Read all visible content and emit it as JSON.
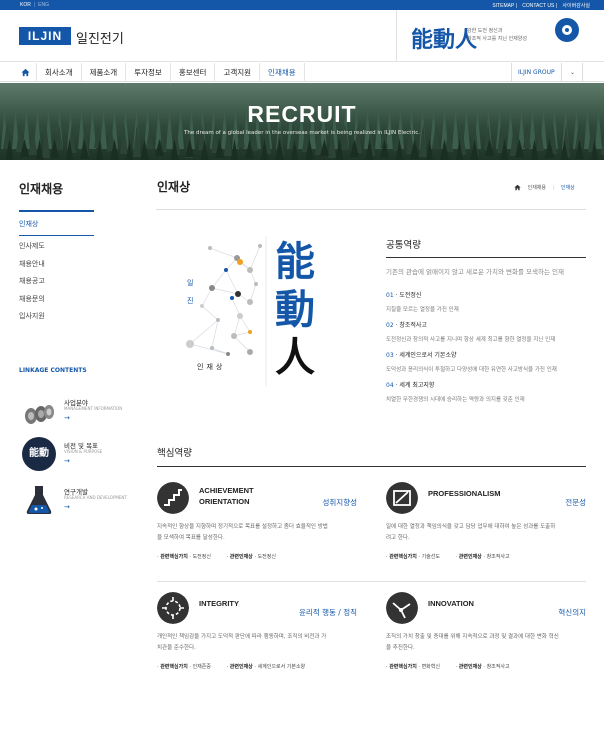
{
  "topbar": {
    "lang_kor": "KOR",
    "lang_eng": "ENG",
    "sitemap": "SITEMAP",
    "contact": "CONTACT US",
    "audit": "사이버감사실"
  },
  "header": {
    "logo": "ILJIN",
    "company": "일진전기",
    "slogan_main": "能動人",
    "slogan_line1": "강한 도전 정신과",
    "slogan_line2": "창조적 사고를 지닌 인재양성"
  },
  "nav": {
    "items": [
      "회사소개",
      "제품소개",
      "투자정보",
      "홍보센터",
      "고객지원",
      "인재채용"
    ],
    "group": "ILJIN GROUP",
    "chevron": "⌄"
  },
  "hero": {
    "title": "RECRUIT",
    "subtitle": "The dream of a global leader in the overseas market is being realized in ILJIN Electric."
  },
  "sidebar": {
    "title": "인재채용",
    "active": "인재상",
    "items": [
      "인사제도",
      "채용안내",
      "채용공고",
      "채용문의",
      "입사지원"
    ]
  },
  "linkage": {
    "title": "LINKAGE CONTENTS",
    "items": [
      {
        "label": "사업분야",
        "sub": "MANAGEMENT INFORMATION",
        "arrow": "→",
        "icon": "cable-reel-icon"
      },
      {
        "label": "비전 및 목표",
        "sub": "VISION & PURPOSE",
        "arrow": "→",
        "icon": "vision-badge-icon",
        "badge": "能動"
      },
      {
        "label": "연구개발",
        "sub": "RESEARCH AND DEVELOPMENT",
        "arrow": "→",
        "icon": "flask-icon"
      }
    ]
  },
  "main": {
    "title": "인재상",
    "breadcrumb": [
      "인재채용",
      "인재상"
    ]
  },
  "art": {
    "kanji1": "能",
    "kanji2": "動",
    "kanji3": "人",
    "side1": "일",
    "side2": "진",
    "label": "인재상"
  },
  "common": {
    "title": "공통역량",
    "desc": "기존의 관습에 얽매이지 않고 새로운 가치와 변화를 모색하는 인재",
    "items": [
      {
        "num": "01",
        "name": "도전정신",
        "desc": "지칠줄 모르는 열정을 가진 인재"
      },
      {
        "num": "02",
        "name": "창조적사고",
        "desc": "도전정신과 창의적 사고를 지니며 항상 세계 최고를 향한 열정을 지닌 인재"
      },
      {
        "num": "03",
        "name": "세계인으로서 기본소양",
        "desc": "도덕성과 윤리의식이 투철하고 다양성에 대한 유연한 사고방식을 가진 인재"
      },
      {
        "num": "04",
        "name": "세계 최고지향",
        "desc": "치열한 무한경쟁의 시대에 승리하는 역량과 의지를 갖춘 인재"
      }
    ]
  },
  "core": {
    "title": "핵심역량",
    "cards": [
      {
        "en1": "ACHIEVEMENT",
        "en2": "ORIENTATION",
        "kr": "성취지향성",
        "icon": "stairs-icon",
        "desc1": "지속적인 향상을 지향하며 정기적으로 목표를 설정하고 좀더 효율적인 방법",
        "desc2": "을 모색하여 목표를 달성한다.",
        "tag1_label": "관련핵심가치",
        "tag1_val": "도전정신",
        "tag2_label": "관련인재상",
        "tag2_val": "도전정신"
      },
      {
        "en1": "PROFESSIONALISM",
        "en2": "",
        "kr": "전문성",
        "icon": "professional-icon",
        "desc1": "일에 대한 열정과 책임의식을 갖고 담당 업무에 대하여 높은 성과를 도출하",
        "desc2": "려고 한다.",
        "tag1_label": "관련핵심가치",
        "tag1_val": "기술선도",
        "tag2_label": "관련인재상",
        "tag2_val": "창조적사고"
      },
      {
        "en1": "INTEGRITY",
        "en2": "",
        "kr": "윤리적 행동 / 정직",
        "icon": "integrity-icon",
        "desc1": "개인적인 책임감을 가지고 도덕적 판단에 따라 행동하며, 조직의 비전과 가",
        "desc2": "치관을 준수한다.",
        "tag1_label": "관련핵심가치",
        "tag1_val": "인재존중",
        "tag2_label": "관련인재상",
        "tag2_val": "세계인으로서 기본소양"
      },
      {
        "en1": "INNOVATION",
        "en2": "",
        "kr": "혁신의지",
        "icon": "innovation-icon",
        "desc1": "조직의 가치 창출 및 증대를 위해 지속적으로 과정 및 결과에 대한 변화 혁신",
        "desc2": "을 추진한다.",
        "tag1_label": "관련핵심가치",
        "tag1_val": "변화혁신",
        "tag2_label": "관련인재상",
        "tag2_val": "창조적사고"
      }
    ]
  },
  "colors": {
    "brand": "#1457a8",
    "accent": "#f0a020"
  }
}
